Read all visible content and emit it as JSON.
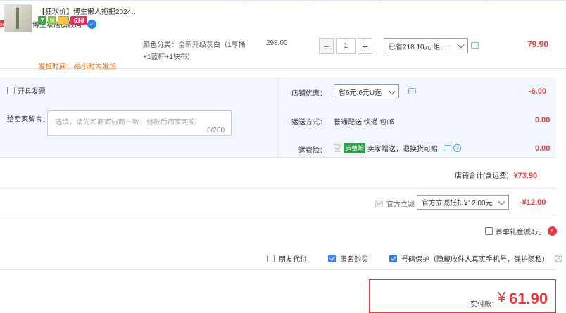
{
  "store": {
    "tag": "好店",
    "label": "店铺：博生家居旗舰店"
  },
  "item": {
    "title": "【狂欢价】博生懒人拖把2024…",
    "badges": [
      "7",
      "保",
      "618"
    ],
    "ship_time": "发货时间：48小时内发货",
    "spec_line1": "颜色分类：全新升级灰白（1厚桶",
    "spec_line2": "+1蓝杆+1块布）",
    "unit_price": "298.00",
    "quantity": "1",
    "discount_select": "已省218.10元:组…",
    "pay": "79.90"
  },
  "options": {
    "invoice_label": "开具发票",
    "message_label": "给卖家留言：",
    "message_placeholder": "选填，请先和商家协商一致，付款后商家可见",
    "message_count": "0/200"
  },
  "right_panel": {
    "coupon_label": "店铺优惠：",
    "coupon_select": "省6元:6元U选",
    "coupon_value": "-6.00",
    "delivery_label": "运送方式：",
    "delivery_value_text": "普通配送 快递 包邮",
    "delivery_value": "0.00",
    "insurance_label": "运费险：",
    "insurance_tag": "运费险",
    "insurance_text": "卖家赠送，退换货可赔",
    "insurance_value": "0.00"
  },
  "store_total": {
    "label": "店铺合计(含运费)",
    "value": "¥73.90"
  },
  "official": {
    "label": "官方立减",
    "select": "官方立减抵扣¥12.00元",
    "value": "-¥12.00"
  },
  "first_order": {
    "label": "首单礼金减4元",
    "icon": "⚡"
  },
  "extras": {
    "friend_pay": "朋友代付",
    "anonymous": "匿名购买",
    "privacy": "号码保护（隐藏收件人真实手机号，保护隐私）"
  },
  "total": {
    "label": "实付款：",
    "currency": "¥",
    "value": "61.90"
  },
  "colors": {
    "accent_red": "#e4393c",
    "link_blue": "#3d7ef0",
    "panel_bg": "#f2f7ff",
    "ship_orange": "#ff6600"
  }
}
